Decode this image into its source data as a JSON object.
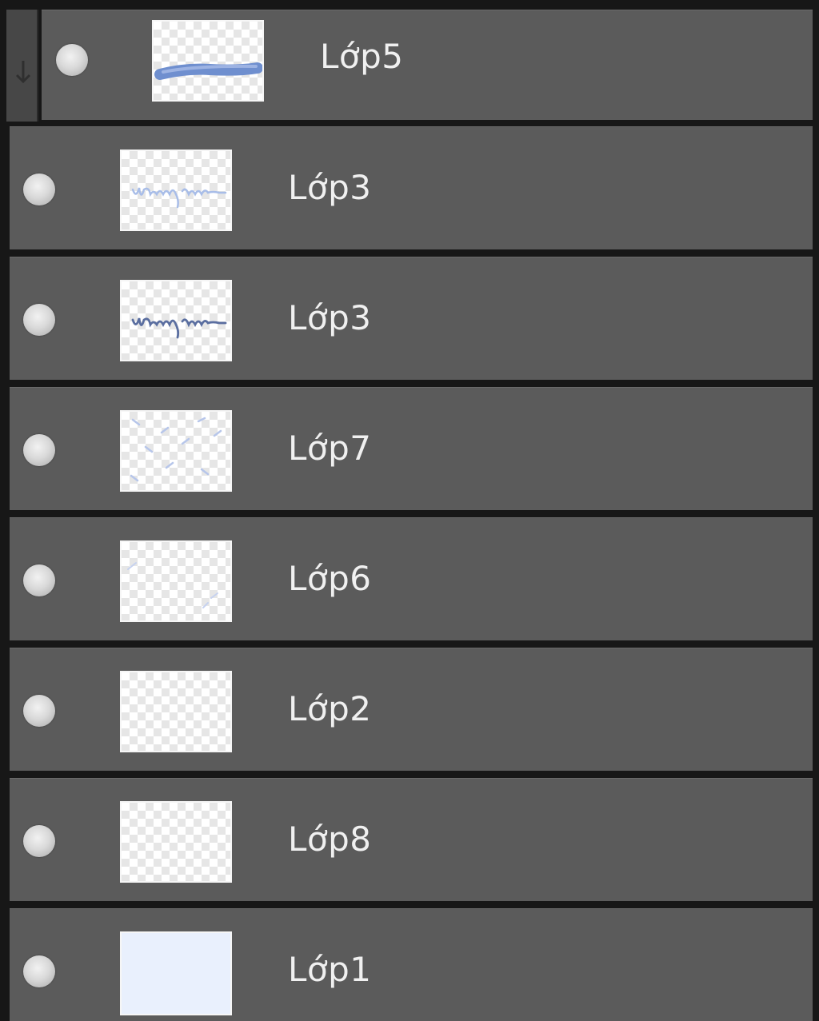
{
  "layers_panel": {
    "layers": [
      {
        "name": "Lớp5",
        "thumbnail": "blue-stroke",
        "clipped": true
      },
      {
        "name": "Lớp3",
        "thumbnail": "light-handwriting",
        "clipped": false
      },
      {
        "name": "Lớp3",
        "thumbnail": "dark-handwriting",
        "clipped": false
      },
      {
        "name": "Lớp7",
        "thumbnail": "scattered-marks",
        "clipped": false
      },
      {
        "name": "Lớp6",
        "thumbnail": "faint-marks",
        "clipped": false
      },
      {
        "name": "Lớp2",
        "thumbnail": "transparent",
        "clipped": false
      },
      {
        "name": "Lớp8",
        "thumbnail": "transparent",
        "clipped": false
      },
      {
        "name": "Lớp1",
        "thumbnail": "solid-light-blue",
        "clipped": false
      }
    ],
    "colors": {
      "row_bg": "#5b5b5b",
      "separator": "#171717",
      "text": "#f0f0f0",
      "blue_stroke": "#6f8fcf",
      "fill_light_blue": "#e9f0fd"
    }
  }
}
